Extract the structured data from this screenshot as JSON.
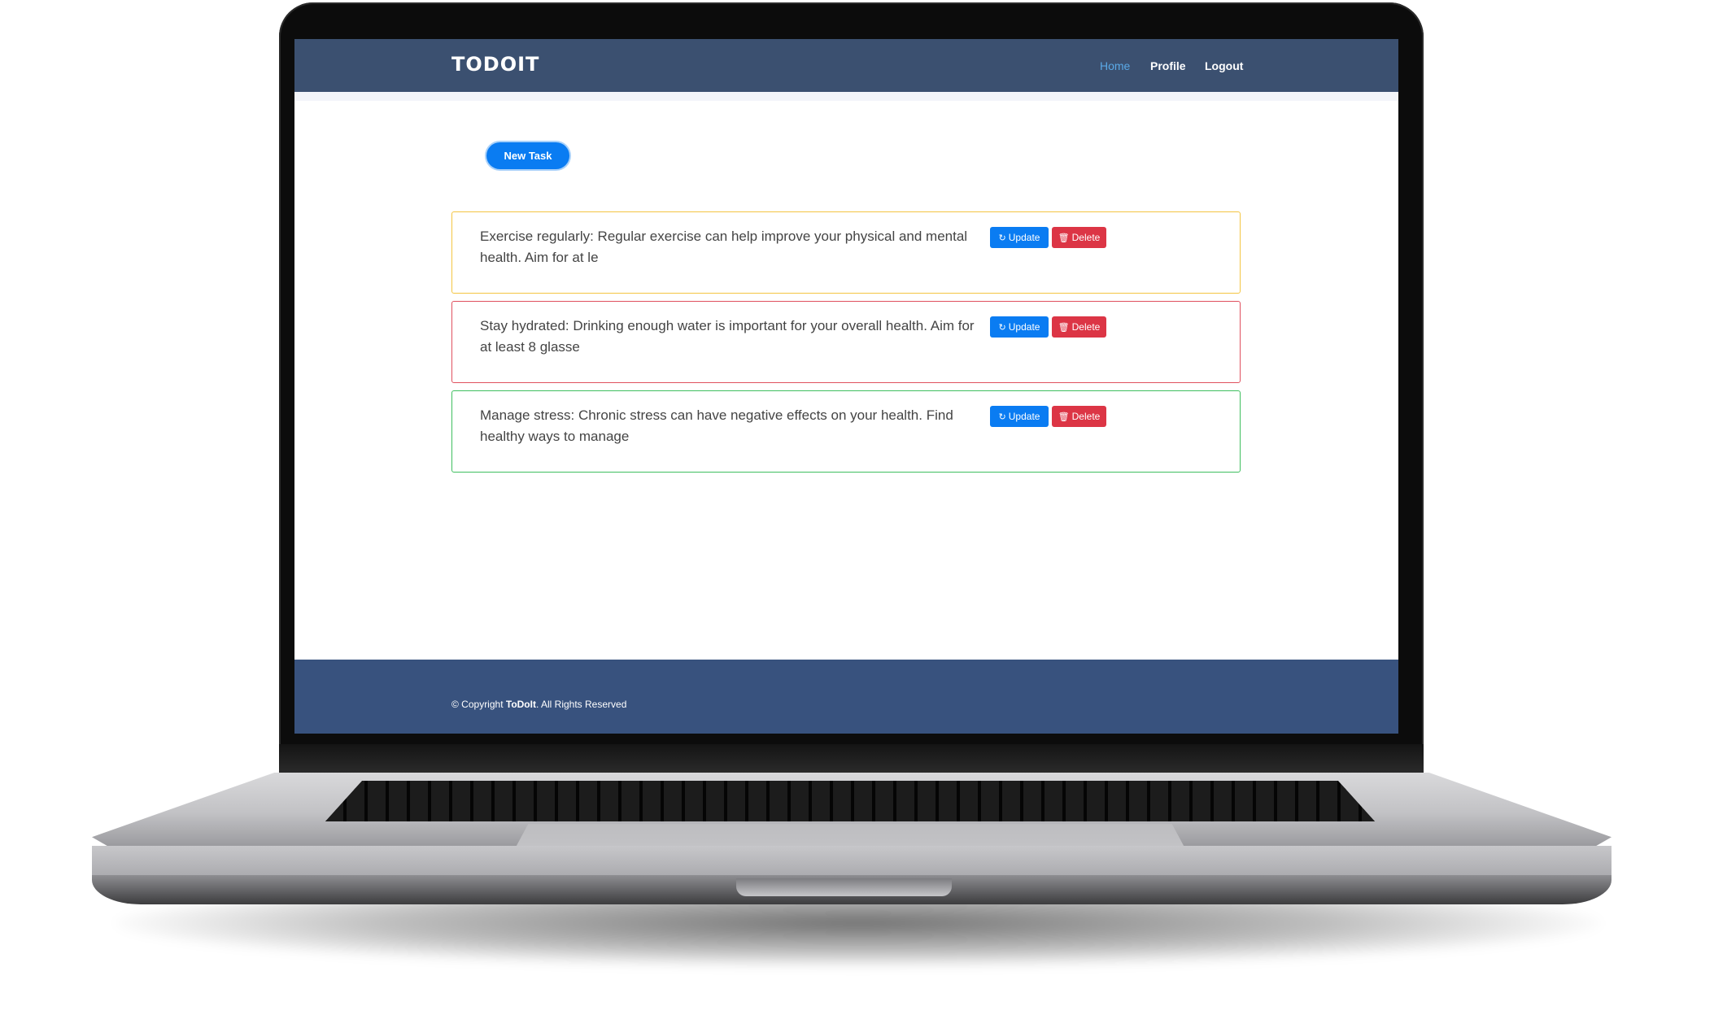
{
  "navbar": {
    "brand": "TODOIT",
    "links": [
      {
        "label": "Home",
        "active": true
      },
      {
        "label": "Profile",
        "active": false
      },
      {
        "label": "Logout",
        "active": false
      }
    ]
  },
  "main": {
    "new_task_label": "New Task",
    "tasks": [
      {
        "text": "Exercise regularly: Regular exercise can help improve your physical and mental health. Aim for at le",
        "border_color": "#f4c542",
        "update_label": "Update",
        "delete_label": "Delete"
      },
      {
        "text": "Stay hydrated: Drinking enough water is important for your overall health. Aim for at least 8 glasse",
        "border_color": "#e0505e",
        "update_label": "Update",
        "delete_label": "Delete"
      },
      {
        "text": "Manage stress: Chronic stress can have negative effects on your health. Find healthy ways to manage",
        "border_color": "#3fbf5f",
        "update_label": "Update",
        "delete_label": "Delete"
      }
    ]
  },
  "footer": {
    "copyright_prefix": "© Copyright ",
    "brand": "ToDoIt",
    "suffix": ". All Rights Reserved"
  },
  "colors": {
    "navbar": "#3b5070",
    "footer": "#38527e",
    "primary": "#0a7cf2",
    "danger": "#dc3545",
    "active_link": "#5aa9e6"
  },
  "icons": {
    "update": "refresh-icon",
    "delete": "trash-icon"
  }
}
